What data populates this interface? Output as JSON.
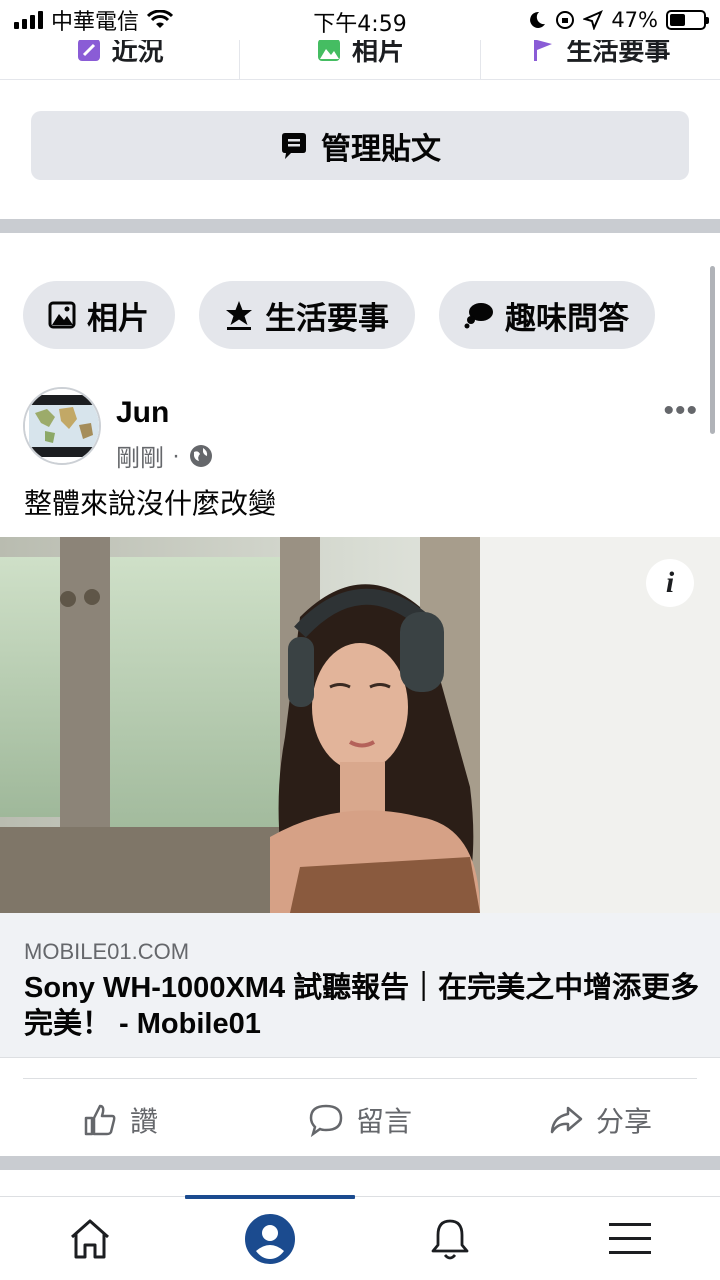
{
  "status_bar": {
    "carrier": "中華電信",
    "time": "下午4:59",
    "battery": "47%",
    "battery_level": 0.47
  },
  "top_tabs": [
    {
      "label": "近況",
      "icon": "edit-icon"
    },
    {
      "label": "相片",
      "icon": "photo-icon"
    },
    {
      "label": "生活要事",
      "icon": "flag-icon"
    }
  ],
  "manage_posts": {
    "label": "管理貼文"
  },
  "chips": [
    {
      "label": "相片",
      "icon": "photo-icon"
    },
    {
      "label": "生活要事",
      "icon": "star-icon"
    },
    {
      "label": "趣味問答",
      "icon": "speech-bubble-icon"
    }
  ],
  "post": {
    "author": "Jun",
    "time": "剛剛",
    "separator": "·",
    "text": "整體來說沒什麼改變",
    "avatar_text_top": "THE WORLD IS A CAT",
    "avatar_text_bottom": "PLAYING WITH AUSTRALIA",
    "link": {
      "domain": "MOBILE01.COM",
      "title": "Sony WH-1000XM4 試聽報告｜在完美之中增添更多完美！ - Mobile01"
    },
    "actions": [
      {
        "label": "讚",
        "icon": "thumbs-up-icon"
      },
      {
        "label": "留言",
        "icon": "comment-icon"
      },
      {
        "label": "分享",
        "icon": "share-icon"
      }
    ]
  },
  "bottom_nav": [
    {
      "name": "home",
      "icon": "home-icon"
    },
    {
      "name": "profile",
      "icon": "profile-icon",
      "active": true
    },
    {
      "name": "notifications",
      "icon": "bell-icon"
    },
    {
      "name": "menu",
      "icon": "menu-icon"
    }
  ]
}
